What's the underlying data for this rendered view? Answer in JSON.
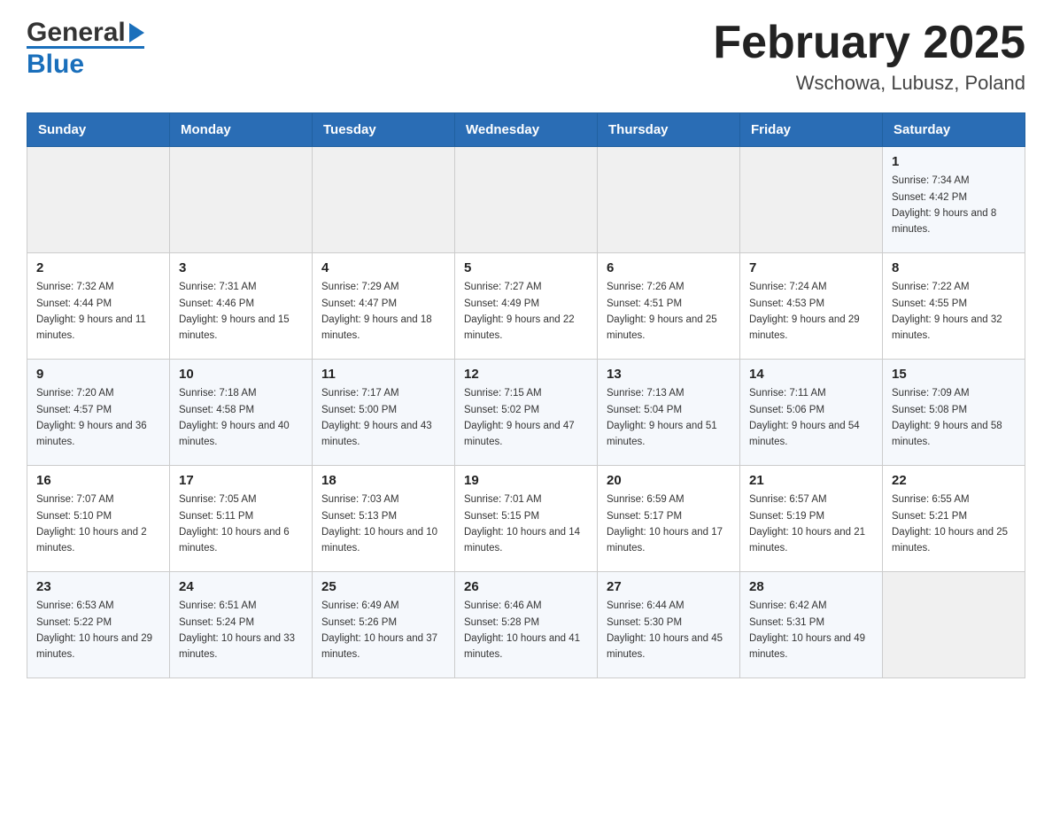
{
  "header": {
    "logo": {
      "general": "General",
      "blue": "Blue",
      "triangle_color": "#1a6fbb"
    },
    "title": "February 2025",
    "location": "Wschowa, Lubusz, Poland"
  },
  "days_of_week": [
    "Sunday",
    "Monday",
    "Tuesday",
    "Wednesday",
    "Thursday",
    "Friday",
    "Saturday"
  ],
  "weeks": [
    {
      "days": [
        {
          "num": "",
          "info": ""
        },
        {
          "num": "",
          "info": ""
        },
        {
          "num": "",
          "info": ""
        },
        {
          "num": "",
          "info": ""
        },
        {
          "num": "",
          "info": ""
        },
        {
          "num": "",
          "info": ""
        },
        {
          "num": "1",
          "info": "Sunrise: 7:34 AM\nSunset: 4:42 PM\nDaylight: 9 hours and 8 minutes."
        }
      ]
    },
    {
      "days": [
        {
          "num": "2",
          "info": "Sunrise: 7:32 AM\nSunset: 4:44 PM\nDaylight: 9 hours and 11 minutes."
        },
        {
          "num": "3",
          "info": "Sunrise: 7:31 AM\nSunset: 4:46 PM\nDaylight: 9 hours and 15 minutes."
        },
        {
          "num": "4",
          "info": "Sunrise: 7:29 AM\nSunset: 4:47 PM\nDaylight: 9 hours and 18 minutes."
        },
        {
          "num": "5",
          "info": "Sunrise: 7:27 AM\nSunset: 4:49 PM\nDaylight: 9 hours and 22 minutes."
        },
        {
          "num": "6",
          "info": "Sunrise: 7:26 AM\nSunset: 4:51 PM\nDaylight: 9 hours and 25 minutes."
        },
        {
          "num": "7",
          "info": "Sunrise: 7:24 AM\nSunset: 4:53 PM\nDaylight: 9 hours and 29 minutes."
        },
        {
          "num": "8",
          "info": "Sunrise: 7:22 AM\nSunset: 4:55 PM\nDaylight: 9 hours and 32 minutes."
        }
      ]
    },
    {
      "days": [
        {
          "num": "9",
          "info": "Sunrise: 7:20 AM\nSunset: 4:57 PM\nDaylight: 9 hours and 36 minutes."
        },
        {
          "num": "10",
          "info": "Sunrise: 7:18 AM\nSunset: 4:58 PM\nDaylight: 9 hours and 40 minutes."
        },
        {
          "num": "11",
          "info": "Sunrise: 7:17 AM\nSunset: 5:00 PM\nDaylight: 9 hours and 43 minutes."
        },
        {
          "num": "12",
          "info": "Sunrise: 7:15 AM\nSunset: 5:02 PM\nDaylight: 9 hours and 47 minutes."
        },
        {
          "num": "13",
          "info": "Sunrise: 7:13 AM\nSunset: 5:04 PM\nDaylight: 9 hours and 51 minutes."
        },
        {
          "num": "14",
          "info": "Sunrise: 7:11 AM\nSunset: 5:06 PM\nDaylight: 9 hours and 54 minutes."
        },
        {
          "num": "15",
          "info": "Sunrise: 7:09 AM\nSunset: 5:08 PM\nDaylight: 9 hours and 58 minutes."
        }
      ]
    },
    {
      "days": [
        {
          "num": "16",
          "info": "Sunrise: 7:07 AM\nSunset: 5:10 PM\nDaylight: 10 hours and 2 minutes."
        },
        {
          "num": "17",
          "info": "Sunrise: 7:05 AM\nSunset: 5:11 PM\nDaylight: 10 hours and 6 minutes."
        },
        {
          "num": "18",
          "info": "Sunrise: 7:03 AM\nSunset: 5:13 PM\nDaylight: 10 hours and 10 minutes."
        },
        {
          "num": "19",
          "info": "Sunrise: 7:01 AM\nSunset: 5:15 PM\nDaylight: 10 hours and 14 minutes."
        },
        {
          "num": "20",
          "info": "Sunrise: 6:59 AM\nSunset: 5:17 PM\nDaylight: 10 hours and 17 minutes."
        },
        {
          "num": "21",
          "info": "Sunrise: 6:57 AM\nSunset: 5:19 PM\nDaylight: 10 hours and 21 minutes."
        },
        {
          "num": "22",
          "info": "Sunrise: 6:55 AM\nSunset: 5:21 PM\nDaylight: 10 hours and 25 minutes."
        }
      ]
    },
    {
      "days": [
        {
          "num": "23",
          "info": "Sunrise: 6:53 AM\nSunset: 5:22 PM\nDaylight: 10 hours and 29 minutes."
        },
        {
          "num": "24",
          "info": "Sunrise: 6:51 AM\nSunset: 5:24 PM\nDaylight: 10 hours and 33 minutes."
        },
        {
          "num": "25",
          "info": "Sunrise: 6:49 AM\nSunset: 5:26 PM\nDaylight: 10 hours and 37 minutes."
        },
        {
          "num": "26",
          "info": "Sunrise: 6:46 AM\nSunset: 5:28 PM\nDaylight: 10 hours and 41 minutes."
        },
        {
          "num": "27",
          "info": "Sunrise: 6:44 AM\nSunset: 5:30 PM\nDaylight: 10 hours and 45 minutes."
        },
        {
          "num": "28",
          "info": "Sunrise: 6:42 AM\nSunset: 5:31 PM\nDaylight: 10 hours and 49 minutes."
        },
        {
          "num": "",
          "info": ""
        }
      ]
    }
  ]
}
